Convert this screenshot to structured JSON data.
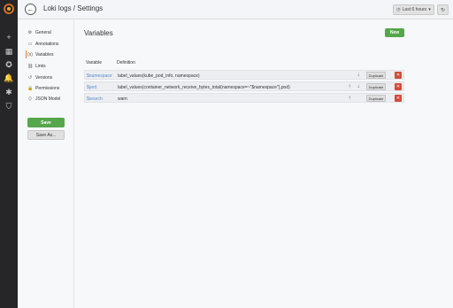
{
  "app": {
    "breadcrumb": "Loki logs / Settings",
    "time_picker": "Last 6 hours",
    "time_picker_caret": "▾",
    "refresh_icon": "↻",
    "back_icon": "←",
    "brand_color": "#f57b1f"
  },
  "sidemenu": {
    "items": [
      {
        "icon": "plus-icon",
        "glyph": "+"
      },
      {
        "icon": "dashboards-icon",
        "glyph": "▦"
      },
      {
        "icon": "explore-icon",
        "glyph": "✪"
      },
      {
        "icon": "alerting-icon",
        "glyph": "🔔"
      },
      {
        "icon": "configuration-icon",
        "glyph": "✱"
      },
      {
        "icon": "shield-icon",
        "glyph": "⛉"
      }
    ]
  },
  "settings_nav": {
    "items": [
      {
        "label": "General",
        "icon": "sliders-icon",
        "glyph": "⚙"
      },
      {
        "label": "Annotations",
        "icon": "comment-icon",
        "glyph": "▭"
      },
      {
        "label": "Variables",
        "icon": "variable-icon",
        "glyph": "(x)"
      },
      {
        "label": "Links",
        "icon": "link-icon",
        "glyph": "⛓"
      },
      {
        "label": "Versions",
        "icon": "history-icon",
        "glyph": "↺"
      },
      {
        "label": "Permissions",
        "icon": "lock-icon",
        "glyph": "🔒"
      },
      {
        "label": "JSON Model",
        "icon": "code-icon",
        "glyph": "⟨⟩"
      }
    ],
    "active": "Variables",
    "save_label": "Save",
    "save_as_label": "Save As..."
  },
  "main": {
    "title": "Variables",
    "new_label": "New",
    "columns": {
      "variable": "Variable",
      "definition": "Definition"
    },
    "rows": [
      {
        "name": "$namespace",
        "definition": "label_values(kube_pod_info, namespace)",
        "up": false,
        "down": true
      },
      {
        "name": "$pod",
        "definition": "label_values(container_network_receive_bytes_total{namespace=~\"$namespace\"},pod)",
        "up": true,
        "down": true
      },
      {
        "name": "$search",
        "definition": "warn",
        "up": true,
        "down": false
      }
    ],
    "duplicate_label": "Duplicate",
    "delete_glyph": "✕",
    "up_glyph": "↑",
    "down_glyph": "↓"
  }
}
